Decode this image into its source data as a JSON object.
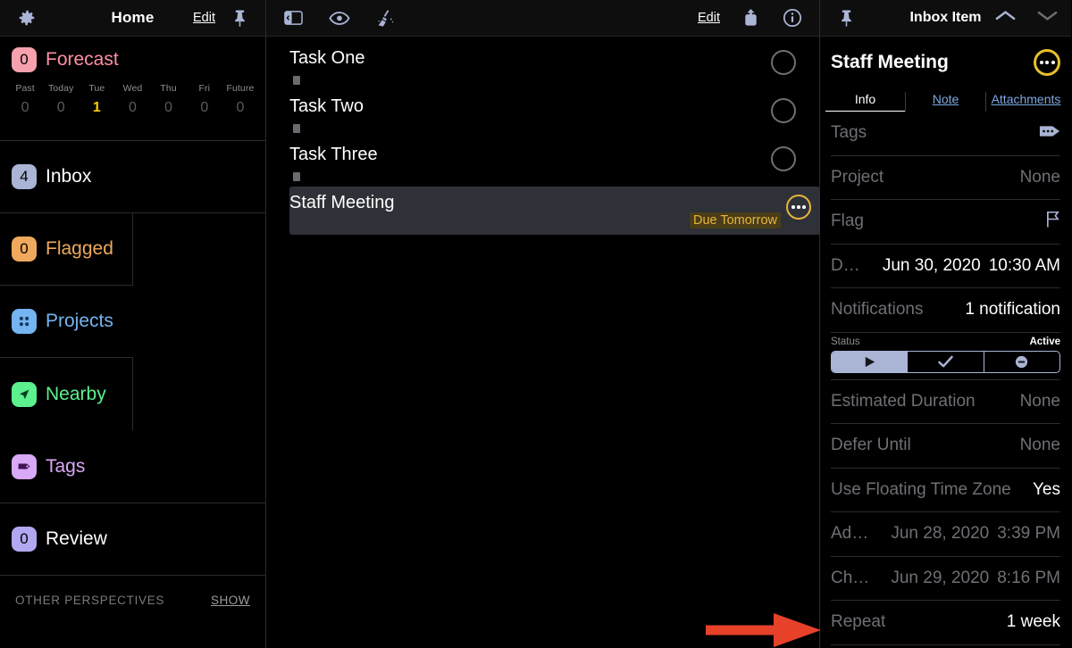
{
  "sidebar": {
    "toolbar": {
      "gear_icon": "gear-icon",
      "title": "Home",
      "edit_label": "Edit",
      "pin_icon": "pin-icon"
    },
    "forecast": {
      "count": "0",
      "label": "Forecast",
      "days": [
        {
          "name": "Past",
          "count": "0",
          "highlight": false
        },
        {
          "name": "Today",
          "count": "0",
          "highlight": false
        },
        {
          "name": "Tue",
          "count": "1",
          "highlight": true
        },
        {
          "name": "Wed",
          "count": "0",
          "highlight": false
        },
        {
          "name": "Thu",
          "count": "0",
          "highlight": false
        },
        {
          "name": "Fri",
          "count": "0",
          "highlight": false
        },
        {
          "name": "Future",
          "count": "0",
          "highlight": false
        }
      ]
    },
    "inbox": {
      "count": "4",
      "label": "Inbox"
    },
    "flagged": {
      "count": "0",
      "label": "Flagged"
    },
    "projects": {
      "label": "Projects",
      "icon": "projects-icon"
    },
    "nearby": {
      "label": "Nearby",
      "icon": "location-arrow-icon"
    },
    "tags": {
      "label": "Tags",
      "icon": "tag-icon"
    },
    "review": {
      "count": "0",
      "label": "Review"
    },
    "other_perspectives": {
      "title": "OTHER PERSPECTIVES",
      "show_label": "SHOW"
    }
  },
  "middle": {
    "toolbar": {
      "sidebar_toggle_icon": "sidebar-toggle-icon",
      "view_icon": "eye-icon",
      "cleanup_icon": "broom-icon",
      "edit_label": "Edit",
      "share_icon": "share-icon",
      "info_icon": "info-icon"
    },
    "tasks": [
      {
        "title": "Task One",
        "has_note": true,
        "selected": false,
        "due": ""
      },
      {
        "title": "Task Two",
        "has_note": true,
        "selected": false,
        "due": ""
      },
      {
        "title": "Task Three",
        "has_note": true,
        "selected": false,
        "due": ""
      },
      {
        "title": "Staff Meeting",
        "has_note": false,
        "selected": true,
        "due": "Due Tomorrow"
      }
    ]
  },
  "inspector": {
    "toolbar": {
      "pin_icon": "pin-icon",
      "title": "Inbox Item",
      "prev_icon": "chevron-up-icon",
      "next_icon": "chevron-down-icon"
    },
    "item_name": "Staff Meeting",
    "tabs": [
      {
        "label": "Info",
        "active": true
      },
      {
        "label": "Note",
        "active": false
      },
      {
        "label": "Attachments",
        "active": false
      }
    ],
    "rows": [
      {
        "key": "Tags",
        "value": "",
        "icon": "tag-icon"
      },
      {
        "key": "Project",
        "value": "None"
      },
      {
        "key": "Flag",
        "value": "",
        "icon": "flag-icon"
      },
      {
        "key": "D…",
        "date": "Jun 30, 2020",
        "time": "10:30 AM",
        "bright": true
      },
      {
        "key": "Notifications",
        "value": "1 notification",
        "bright": true
      },
      {
        "key": "Estimated Duration",
        "value": "None"
      },
      {
        "key": "Defer Until",
        "value": "None"
      },
      {
        "key": "Use Floating Time Zone",
        "value": "Yes",
        "bright": true
      },
      {
        "key": "Ad…",
        "date": "Jun 28, 2020",
        "time": "3:39 PM"
      },
      {
        "key": "Ch…",
        "date": "Jun 29, 2020",
        "time": "8:16 PM"
      },
      {
        "key": "Repeat",
        "value": "1 week",
        "bright": true
      }
    ],
    "status": {
      "label": "Status",
      "value": "Active",
      "segments": [
        {
          "icon": "play-icon",
          "selected": true
        },
        {
          "icon": "check-icon",
          "selected": false
        },
        {
          "icon": "minus-circle-icon",
          "selected": false
        }
      ]
    }
  },
  "annotation": {
    "arrow_icon": "red-arrow-right",
    "color": "#e8412a"
  }
}
